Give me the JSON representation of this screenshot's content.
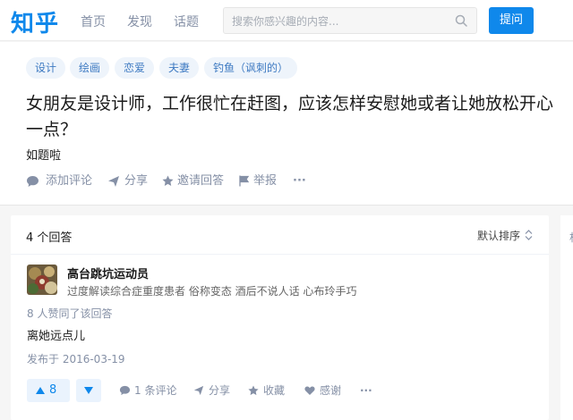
{
  "header": {
    "logo": "知乎",
    "nav": [
      "首页",
      "发现",
      "话题"
    ],
    "search_placeholder": "搜索你感兴趣的内容...",
    "ask_label": "提问"
  },
  "question": {
    "tags": [
      "设计",
      "绘画",
      "恋爱",
      "夫妻",
      "钓鱼（讽刺的）"
    ],
    "title": "女朋友是设计师，工作很忙在赶图，应该怎样安慰她或者让她放松开心一点？",
    "description": "如题啦",
    "actions": {
      "comment": "添加评论",
      "share": "分享",
      "invite": "邀请回答",
      "report": "举报",
      "more": "···"
    }
  },
  "answers": {
    "count_label": "4 个回答",
    "sort_label": "默认排序",
    "side_char": "相",
    "items": [
      {
        "author": "高台跳坑运动员",
        "bio": "过度解读综合症重度患者 俗称变态 酒后不说人话 心布玲手巧",
        "votes_line": "8 人赞同了该回答",
        "content": "离她远点儿",
        "date": "发布于 2016-03-19",
        "upvotes": "8",
        "comments": "1 条评论",
        "share": "分享",
        "collect": "收藏",
        "thanks": "感谢",
        "more": "···"
      }
    ]
  },
  "colors": {
    "brand": "#0f88eb",
    "tag_bg": "#eef4fb",
    "tag_text": "#3e7ac2",
    "muted": "#8590a6"
  }
}
